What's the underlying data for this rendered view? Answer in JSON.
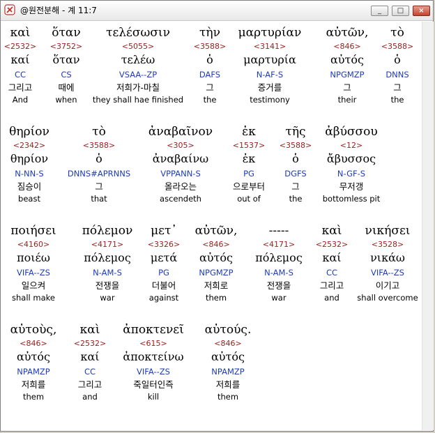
{
  "window": {
    "title": "@원전분해 - 계 11:7",
    "buttons": [
      "_",
      "□",
      "×"
    ]
  },
  "rows": [
    [
      {
        "g": "καὶ",
        "n": "<2532>",
        "l": "καί",
        "m": "CC",
        "k": "그리고",
        "e": "And"
      },
      {
        "g": "ὅταν",
        "n": "<3752>",
        "l": "ὅταν",
        "m": "CS",
        "k": "때에",
        "e": "when"
      },
      {
        "g": "τελέσωσιν",
        "n": "<5055>",
        "l": "τελέω",
        "m": "VSAA--ZP",
        "k": "저희가-마칠",
        "e": "they shall hae finished"
      },
      {
        "g": "τὴν",
        "n": "<3588>",
        "l": "ὁ",
        "m": "DAFS",
        "k": "그",
        "e": "the"
      },
      {
        "g": "μαρτυρίαν",
        "n": "<3141>",
        "l": "μαρτυρία",
        "m": "N-AF-S",
        "k": "증거를",
        "e": "testimony"
      },
      {
        "g": "αὐτῶν,",
        "n": "<846>",
        "l": "αὐτός",
        "m": "NPGMZP",
        "k": "그",
        "e": "their"
      },
      {
        "g": "τὸ",
        "n": "<3588>",
        "l": "ὁ",
        "m": "DNNS",
        "k": "그",
        "e": "the"
      }
    ],
    [
      {
        "g": "θηρίον",
        "n": "<2342>",
        "l": "θηρίον",
        "m": "N-NN-S",
        "k": "짐승이",
        "e": "beast"
      },
      {
        "g": "τὸ",
        "n": "<3588>",
        "l": "ὁ",
        "m": "DNNS#APRNNS",
        "k": "그",
        "e": "that"
      },
      {
        "g": "ἀναβαῖνον",
        "n": "<305>",
        "l": "ἀναβαίνω",
        "m": "VPPANN-S",
        "k": "올라오는",
        "e": "ascendeth"
      },
      {
        "g": "ἐκ",
        "n": "<1537>",
        "l": "ἐκ",
        "m": "PG",
        "k": "으로부터",
        "e": "out of"
      },
      {
        "g": "τῆς",
        "n": "<3588>",
        "l": "ὁ",
        "m": "DGFS",
        "k": "그",
        "e": "the"
      },
      {
        "g": "ἀβύσσου",
        "n": "<12>",
        "l": "ἄβυσσος",
        "m": "N-GF-S",
        "k": "무저갱",
        "e": "bottomless pit"
      }
    ],
    [
      {
        "g": "ποιήσει",
        "n": "<4160>",
        "l": "ποιέω",
        "m": "VIFA--ZS",
        "k": "일으켜",
        "e": "shall make"
      },
      {
        "g": "πόλεμον",
        "n": "<4171>",
        "l": "πόλεμος",
        "m": "N-AM-S",
        "k": "전쟁을",
        "e": "war"
      },
      {
        "g": "μετ᾽",
        "n": "<3326>",
        "l": "μετά",
        "m": "PG",
        "k": "더불어",
        "e": "against"
      },
      {
        "g": "αὐτῶν,",
        "n": "<846>",
        "l": "αὐτός",
        "m": "NPGMZP",
        "k": "저희로",
        "e": "them"
      },
      {
        "g": "-----",
        "n": "<4171>",
        "l": "πόλεμος",
        "m": "N-AM-S",
        "k": "전쟁을",
        "e": "war"
      },
      {
        "g": "καὶ",
        "n": "<2532>",
        "l": "καί",
        "m": "CC",
        "k": "그리고",
        "e": "and"
      },
      {
        "g": "νικήσει",
        "n": "<3528>",
        "l": "νικάω",
        "m": "VIFA--ZS",
        "k": "이기고",
        "e": "shall overcome"
      }
    ],
    [
      {
        "g": "αὐτοὺς,",
        "n": "<846>",
        "l": "αὐτός",
        "m": "NPAMZP",
        "k": "저희를",
        "e": "them"
      },
      {
        "g": "καὶ",
        "n": "<2532>",
        "l": "καί",
        "m": "CC",
        "k": "그리고",
        "e": "and"
      },
      {
        "g": "ἀποκτενεῖ",
        "n": "<615>",
        "l": "ἀποκτείνω",
        "m": "VIFA--ZS",
        "k": "죽일터인즉",
        "e": "kill"
      },
      {
        "g": "αὐτούς.",
        "n": "<846>",
        "l": "αὐτός",
        "m": "NPAMZP",
        "k": "저희를",
        "e": "them"
      }
    ]
  ]
}
